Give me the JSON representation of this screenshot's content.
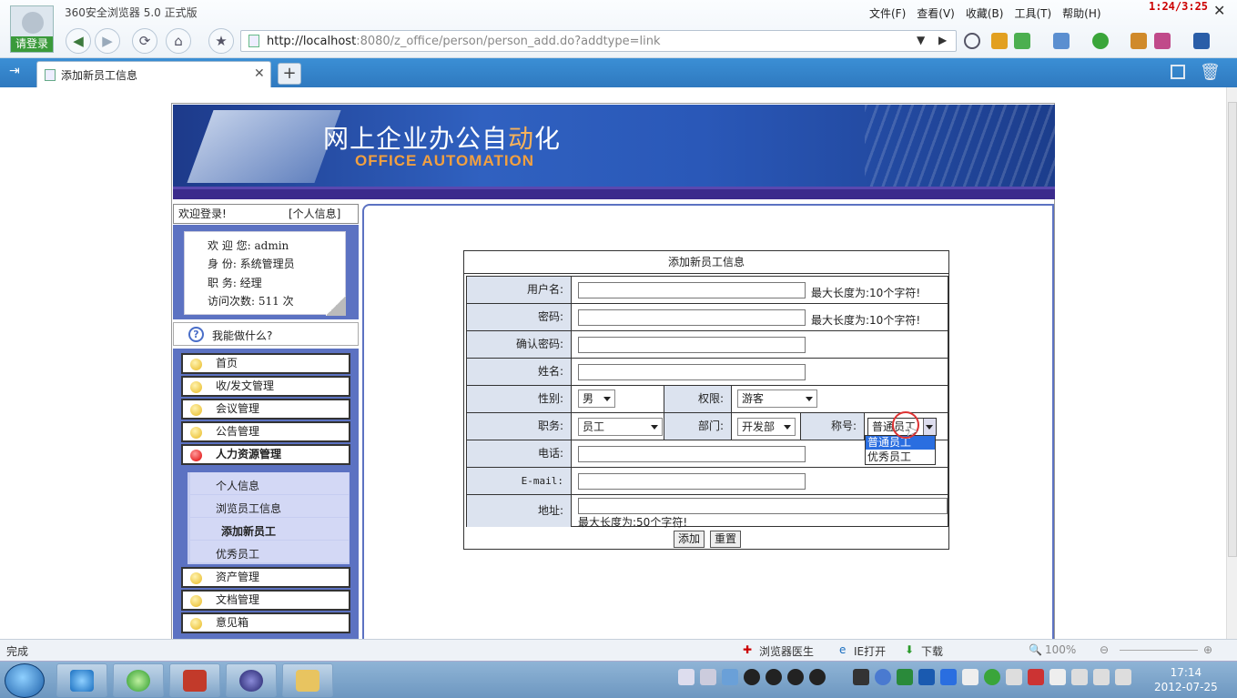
{
  "browser": {
    "title": "360安全浏览器 5.0 正式版",
    "login_label": "请登录",
    "menus": [
      "文件(F)",
      "查看(V)",
      "收藏(B)",
      "工具(T)",
      "帮助(H)"
    ],
    "clock": "1:24/3:25",
    "url_host": "http://localhost",
    "url_rest": ":8080/z_office/person/person_add.do?addtype=link",
    "tab_title": "添加新员工信息"
  },
  "banner": {
    "title_a": "网上企业办公自",
    "title_b": "动",
    "title_c": "化",
    "subtitle": "OFFICE AUTOMATION"
  },
  "sidebar": {
    "welcome": "欢迎登录!",
    "personal_link": "[个人信息]",
    "user_rows": [
      "欢 迎 您: admin",
      "身    份: 系统管理员",
      "职    务: 经理",
      "访问次数: 511 次"
    ],
    "help": "我能做什么?",
    "menu": [
      "首页",
      "收/发文管理",
      "会议管理",
      "公告管理",
      "人力资源管理"
    ],
    "submenu": [
      "个人信息",
      "浏览员工信息",
      "添加新员工",
      "优秀员工"
    ],
    "menu_after": [
      "资产管理",
      "文档管理",
      "意见箱"
    ]
  },
  "form": {
    "title": "添加新员工信息",
    "username_label": "用户名:",
    "username_hint": "最大长度为:10个字符!",
    "password_label": "密码:",
    "password_hint": "最大长度为:10个字符!",
    "confirm_label": "确认密码:",
    "name_label": "姓名:",
    "gender_label": "性别:",
    "gender_value": "男",
    "perm_label": "权限:",
    "perm_value": "游客",
    "post_label": "职务:",
    "post_value": "员工",
    "dept_label": "部门:",
    "dept_value": "开发部",
    "rank_label": "称号:",
    "rank_value": "普通员工",
    "rank_options": [
      "普通员工",
      "优秀员工"
    ],
    "phone_label": "电话:",
    "email_label": "E-mail:",
    "addr_label": "地址:",
    "addr_hint": "最大长度为:50个字符!",
    "submit": "添加",
    "reset": "重置"
  },
  "status": {
    "left": "完成",
    "doctor": "浏览器医生",
    "ie": "IE打开",
    "download": "下载",
    "zoom": "100%"
  },
  "taskbar": {
    "time": "17:14",
    "date": "2012-07-25"
  }
}
